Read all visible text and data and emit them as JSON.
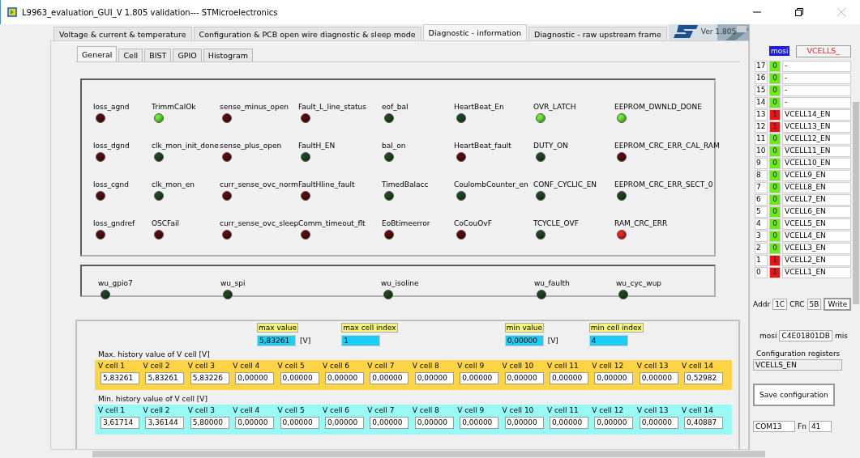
{
  "window": {
    "title": "L9963_evaluation_GUI_V 1.805 validation--- STMicroelectronics"
  },
  "tabs": [
    {
      "label": "Voltage & current &  temperature",
      "selected": false
    },
    {
      "label": "Configuration & PCB open wire  diagnostic & sleep mode",
      "selected": false
    },
    {
      "label": "Diagnostic - information",
      "selected": true
    },
    {
      "label": "Diagnostic - raw upstream  frame",
      "selected": false
    }
  ],
  "banner": {
    "version": "Ver 1.805"
  },
  "subtabs": [
    {
      "label": "General",
      "selected": true
    },
    {
      "label": "Cell",
      "selected": false
    },
    {
      "label": "BIST",
      "selected": false
    },
    {
      "label": "GPIO",
      "selected": false
    },
    {
      "label": "Histogram",
      "selected": false
    }
  ],
  "status_flags": [
    {
      "label": "loss_agnd",
      "color": "#5a0c0c"
    },
    {
      "label": "TrimmCalOk",
      "color": "#66ee33"
    },
    {
      "label": "sense_minus_open",
      "color": "#5a0c0c"
    },
    {
      "label": "Fault_L_line_status",
      "color": "#5a0c0c"
    },
    {
      "label": "eof_bal",
      "color": "#1f461f"
    },
    {
      "label": "HeartBeat_En",
      "color": "#1f461f"
    },
    {
      "label": "OVR_LATCH",
      "color": "#66ee33"
    },
    {
      "label": "EEPROM_DWNLD_DONE",
      "color": "#66ee33"
    },
    {
      "label": "loss_dgnd",
      "color": "#5a0c0c"
    },
    {
      "label": "clk_mon_init_done",
      "color": "#1f461f"
    },
    {
      "label": "sense_plus_open",
      "color": "#5a0c0c"
    },
    {
      "label": "FaultH_EN",
      "color": "#1f461f"
    },
    {
      "label": "bal_on",
      "color": "#1f461f"
    },
    {
      "label": "HeartBeat_fault",
      "color": "#5a0c0c"
    },
    {
      "label": "DUTY_ON",
      "color": "#1f461f"
    },
    {
      "label": "EEPROM_CRC_ERR_CAL_RAM",
      "color": "#5a0c0c"
    },
    {
      "label": "loss_cgnd",
      "color": "#5a0c0c"
    },
    {
      "label": "clk_mon_en",
      "color": "#1f461f"
    },
    {
      "label": "curr_sense_ovc_norm",
      "color": "#5a0c0c"
    },
    {
      "label": "FaultHline_fault",
      "color": "#5a0c0c"
    },
    {
      "label": "TimedBalacc",
      "color": "#1f461f"
    },
    {
      "label": "CoulombCounter_en",
      "color": "#1f461f"
    },
    {
      "label": "CONF_CYCLIC_EN",
      "color": "#1f461f"
    },
    {
      "label": "EEPROM_CRC_ERR_SECT_0",
      "color": "#1f461f"
    },
    {
      "label": "loss_gndref",
      "color": "#5a0c0c"
    },
    {
      "label": "OSCFail",
      "color": "#5a0c0c"
    },
    {
      "label": "curr_sense_ovc_sleep",
      "color": "#5a0c0c"
    },
    {
      "label": "Comm_timeout_flt",
      "color": "#5a0c0c"
    },
    {
      "label": "EoBtimeerror",
      "color": "#5a0c0c"
    },
    {
      "label": "CoCouOvF",
      "color": "#5a0c0c"
    },
    {
      "label": "TCYCLE_OVF",
      "color": "#1f461f"
    },
    {
      "label": "RAM_CRC_ERR",
      "color": "#ee2222"
    }
  ],
  "wakeup_flags": [
    {
      "label": "wu_gpio7",
      "color": "#1f461f"
    },
    {
      "label": "wu_spi",
      "color": "#1f461f"
    },
    {
      "label": "wu_isoline",
      "color": "#1f461f"
    },
    {
      "label": "wu_faulth",
      "color": "#1f461f"
    },
    {
      "label": "wu_cyc_wup",
      "color": "#1f461f"
    }
  ],
  "summary": [
    {
      "label": "max value",
      "value": "5,83261",
      "unit": "[V]"
    },
    {
      "label": "max cell index",
      "value": "1"
    },
    {
      "label": "min value",
      "value": "0,00000",
      "unit": "[V]"
    },
    {
      "label": "min cell index",
      "value": "4"
    }
  ],
  "history": [
    {
      "title": "Max. history value of  V cell [V]",
      "kind": "max",
      "cells": [
        {
          "label": "V cell 1",
          "value": "5,83261"
        },
        {
          "label": "V cell 2",
          "value": "5,83261"
        },
        {
          "label": "V cell 3",
          "value": "5,83226"
        },
        {
          "label": "V cell 4",
          "value": "0,00000"
        },
        {
          "label": "V cell 5",
          "value": "0,00000"
        },
        {
          "label": "V cell 6",
          "value": "0,00000"
        },
        {
          "label": "V cell 7",
          "value": "0,00000"
        },
        {
          "label": "V cell 8",
          "value": "0,00000"
        },
        {
          "label": "V cell 9",
          "value": "0,00000"
        },
        {
          "label": "V cell 10",
          "value": "0,00000"
        },
        {
          "label": "V cell 11",
          "value": "0,00000"
        },
        {
          "label": "V cell 12",
          "value": "0,00000"
        },
        {
          "label": "V cell 13",
          "value": "0,00000"
        },
        {
          "label": "V cell 14",
          "value": "0,52982"
        }
      ]
    },
    {
      "title": "Min. history value of  V cell [V]",
      "kind": "min",
      "cells": [
        {
          "label": "V cell 1",
          "value": "3,61714"
        },
        {
          "label": "V cell 2",
          "value": "3,36144"
        },
        {
          "label": "V cell 3",
          "value": "5,80000"
        },
        {
          "label": "V cell 4",
          "value": "0,00000"
        },
        {
          "label": "V cell 5",
          "value": "0,00000"
        },
        {
          "label": "V cell 6",
          "value": "0,00000"
        },
        {
          "label": "V cell 7",
          "value": "0,00000"
        },
        {
          "label": "V cell 8",
          "value": "0,00000"
        },
        {
          "label": "V cell 9",
          "value": "0,00000"
        },
        {
          "label": "V cell 10",
          "value": "0,00000"
        },
        {
          "label": "V cell 11",
          "value": "0,00000"
        },
        {
          "label": "V cell 12",
          "value": "0,00000"
        },
        {
          "label": "V cell 13",
          "value": "0,00000"
        },
        {
          "label": "V cell 14",
          "value": "0,40887"
        }
      ]
    }
  ],
  "side_panel": {
    "mosi_label": "mosi",
    "register_field": "VCELLS_",
    "bits": [
      {
        "index": "17",
        "bit": "0",
        "color": "#66ee11",
        "name": "-"
      },
      {
        "index": "16",
        "bit": "0",
        "color": "#66ee11",
        "name": "-"
      },
      {
        "index": "15",
        "bit": "0",
        "color": "#66ee11",
        "name": "-"
      },
      {
        "index": "14",
        "bit": "0",
        "color": "#66ee11",
        "name": "-"
      },
      {
        "index": "13",
        "bit": "1",
        "color": "#ee1111",
        "name": "VCELL14_EN"
      },
      {
        "index": "12",
        "bit": "1",
        "color": "#ee1111",
        "name": "VCELL13_EN"
      },
      {
        "index": "11",
        "bit": "0",
        "color": "#66ee11",
        "name": "VCELL12_EN"
      },
      {
        "index": "10",
        "bit": "0",
        "color": "#66ee11",
        "name": "VCELL11_EN"
      },
      {
        "index": "9",
        "bit": "0",
        "color": "#66ee11",
        "name": "VCELL10_EN"
      },
      {
        "index": "8",
        "bit": "0",
        "color": "#66ee11",
        "name": "VCELL9_EN"
      },
      {
        "index": "7",
        "bit": "0",
        "color": "#66ee11",
        "name": "VCELL8_EN"
      },
      {
        "index": "6",
        "bit": "0",
        "color": "#66ee11",
        "name": "VCELL7_EN"
      },
      {
        "index": "5",
        "bit": "0",
        "color": "#66ee11",
        "name": "VCELL6_EN"
      },
      {
        "index": "4",
        "bit": "0",
        "color": "#66ee11",
        "name": "VCELL5_EN"
      },
      {
        "index": "3",
        "bit": "0",
        "color": "#66ee11",
        "name": "VCELL4_EN"
      },
      {
        "index": "2",
        "bit": "0",
        "color": "#66ee11",
        "name": "VCELL3_EN"
      },
      {
        "index": "1",
        "bit": "1",
        "color": "#ee1111",
        "name": "VCELL2_EN"
      },
      {
        "index": "0",
        "bit": "1",
        "color": "#ee1111",
        "name": "VCELL1_EN"
      }
    ],
    "addr_label": "Addr",
    "addr": "1C",
    "crc_label": "CRC",
    "crc": "5B",
    "write_button": "Write",
    "mosi_value_label": "mosi",
    "mosi_value": "C4E01801DB",
    "miso_label": "mis",
    "config_label": "Configuration registers",
    "config_value": "VCELLS_EN",
    "save_button": "Save configuration",
    "port": "COM13",
    "fn_label": "Fn",
    "fn_value": "41"
  }
}
